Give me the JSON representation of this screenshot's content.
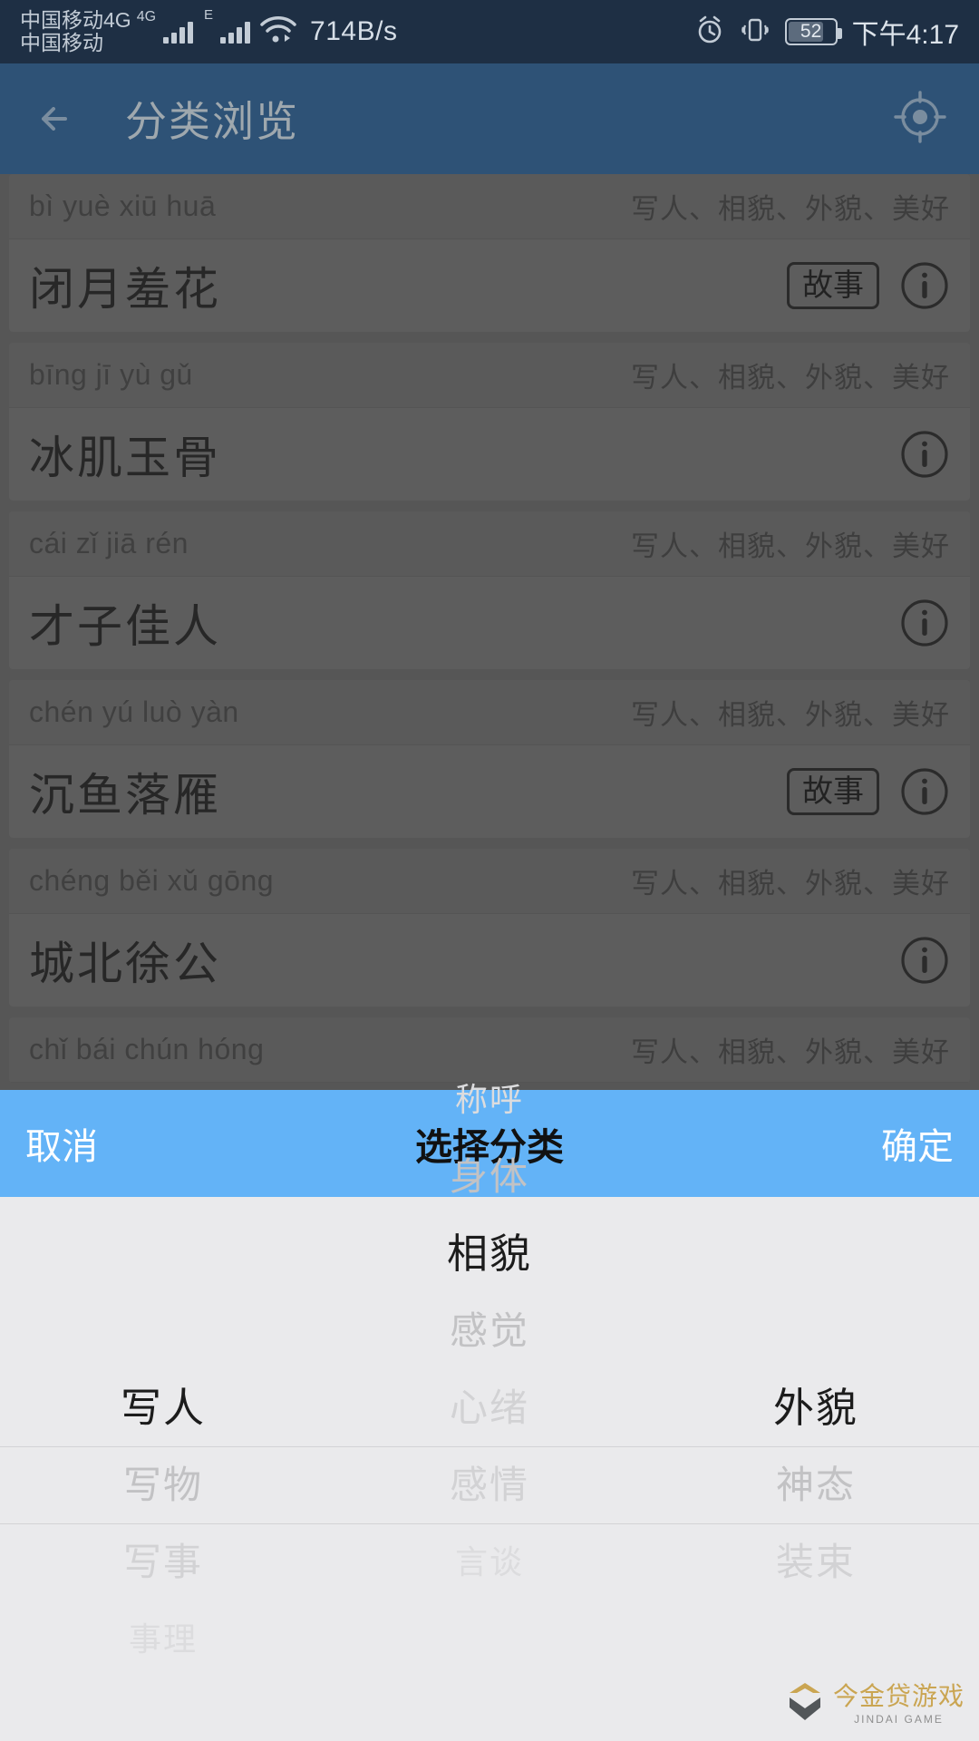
{
  "status_bar": {
    "carrier_line1": "中国移动4G",
    "carrier_line2": "中国移动",
    "net_badge": "4G",
    "data_type": "E",
    "net_speed": "714B/s",
    "battery_level": "52",
    "time": "下午4:17",
    "icons": [
      "signal-bars-icon",
      "signal-bars-icon",
      "wifi-icon",
      "alarm-icon",
      "vibrate-icon",
      "battery-icon"
    ]
  },
  "app_bar": {
    "title": "分类浏览",
    "back_icon": "back-arrow-icon",
    "action_icon": "gps-target-icon"
  },
  "list": {
    "items": [
      {
        "pinyin": "bì yuè xiū huā",
        "tags": "写人、相貌、外貌、美好",
        "idiom": "闭月羞花",
        "badge": "故事",
        "has_info": true
      },
      {
        "pinyin": "bīng jī yù gǔ",
        "tags": "写人、相貌、外貌、美好",
        "idiom": "冰肌玉骨",
        "badge": "",
        "has_info": true
      },
      {
        "pinyin": "cái zǐ jiā rén",
        "tags": "写人、相貌、外貌、美好",
        "idiom": "才子佳人",
        "badge": "",
        "has_info": true
      },
      {
        "pinyin": "chén yú luò yàn",
        "tags": "写人、相貌、外貌、美好",
        "idiom": "沉鱼落雁",
        "badge": "故事",
        "has_info": true
      },
      {
        "pinyin": "chéng běi xǔ gōng",
        "tags": "写人、相貌、外貌、美好",
        "idiom": "城北徐公",
        "badge": "",
        "has_info": true
      },
      {
        "pinyin": "chǐ bái chún hóng",
        "tags": "写人、相貌、外貌、美好",
        "idiom": "",
        "badge": "",
        "has_info": false
      }
    ]
  },
  "picker": {
    "cancel_label": "取消",
    "title": "选择分类",
    "confirm_label": "确定",
    "columns": [
      {
        "name": "column-1",
        "selected_index": 2,
        "options": [
          "",
          "",
          "写人",
          "写物",
          "写事",
          "事理"
        ]
      },
      {
        "name": "column-2",
        "selected_index": 2,
        "options": [
          "称呼",
          "身体",
          "相貌",
          "感觉",
          "心绪",
          "感情",
          "言谈"
        ]
      },
      {
        "name": "column-3",
        "selected_index": 2,
        "options": [
          "",
          "",
          "外貌",
          "神态",
          "装束"
        ]
      }
    ]
  },
  "watermark": {
    "cn": "今金贷游戏",
    "en": "JINDAI GAME"
  },
  "colors": {
    "status_bar_bg": "#1e2f44",
    "app_bar_bg": "#2e5276",
    "picker_accent": "#63b3f7",
    "picker_bg": "#eaeaec",
    "list_bg": "#6e6e6e"
  }
}
